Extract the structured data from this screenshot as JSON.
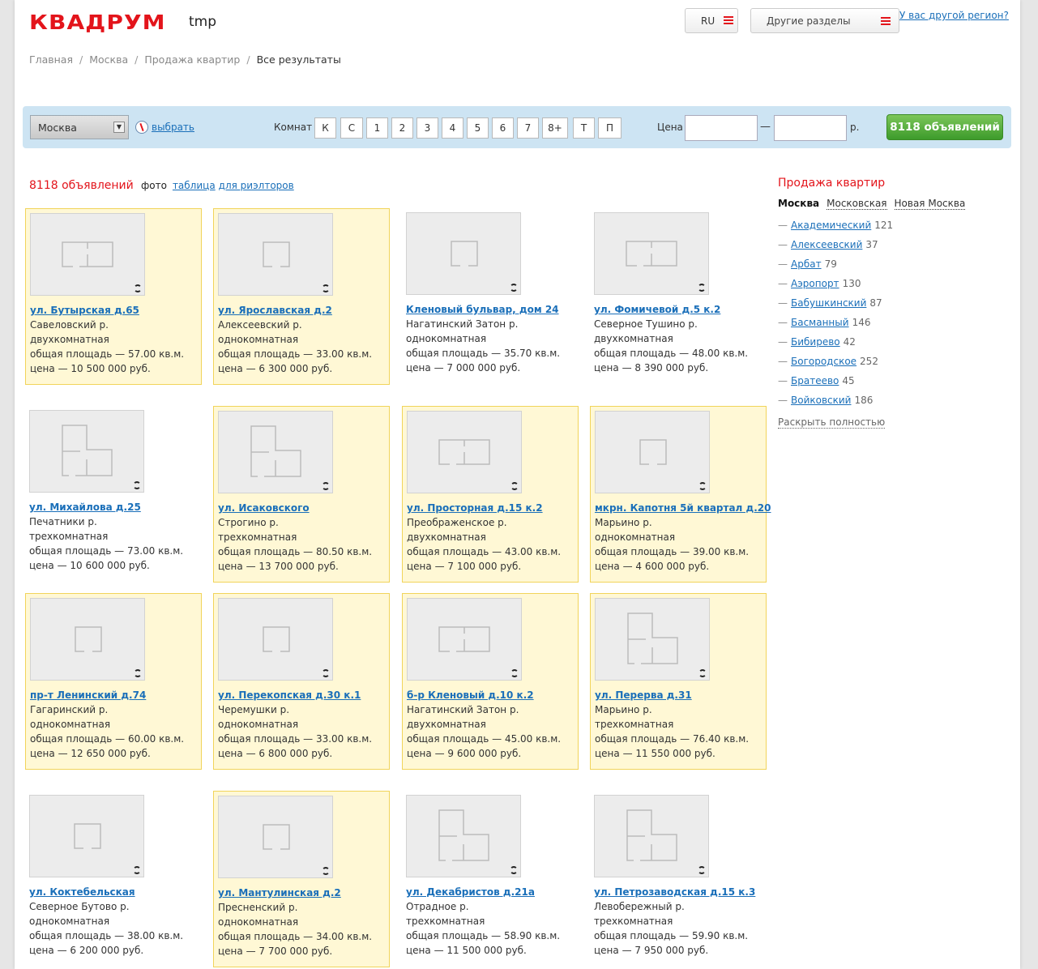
{
  "header": {
    "logo": "КВАДРУМ",
    "site_tag": "tmp",
    "lang": "RU",
    "sections_label": "Другие разделы",
    "region_link": "У вас другой регион?"
  },
  "breadcrumb": [
    "Главная",
    "Москва",
    "Продажа квартир",
    "Все результаты"
  ],
  "filter": {
    "city": "Москва",
    "choose": "выбрать",
    "rooms_label": "Комнат",
    "rooms": [
      "К",
      "С",
      "1",
      "2",
      "3",
      "4",
      "5",
      "6",
      "7",
      "8+",
      "Т",
      "П"
    ],
    "price_label": "Цена",
    "price_from": "",
    "price_to": "",
    "dash": "—",
    "currency": "р.",
    "submit": "8118 объявлений"
  },
  "results": {
    "count_text": "8118 объявлений",
    "view_active": "фото",
    "view_links": [
      "таблица",
      "для риэлторов"
    ]
  },
  "listings": [
    {
      "addr": "ул. Бутырская д.65",
      "district": "Савеловский р.",
      "type": "двухкомнатная",
      "area": "общая площадь — 57.00 кв.м.",
      "price": "цена — 10 500 000 руб.",
      "highlight": true,
      "plan": "two"
    },
    {
      "addr": "ул. Ярославская д.2",
      "district": "Алексеевский р.",
      "type": "однокомнатная",
      "area": "общая площадь — 33.00 кв.м.",
      "price": "цена — 6 300 000 руб.",
      "highlight": true,
      "plan": "one"
    },
    {
      "addr": "Кленовый бульвар, дом 24",
      "district": "Нагатинский Затон р.",
      "type": "однокомнатная",
      "area": "общая площадь — 35.70 кв.м.",
      "price": "цена — 7 000 000 руб.",
      "highlight": false,
      "plan": "one"
    },
    {
      "addr": "ул. Фомичевой д.5 к.2",
      "district": "Северное Тушино р.",
      "type": "двухкомнатная",
      "area": "общая площадь — 48.00 кв.м.",
      "price": "цена — 8 390 000 руб.",
      "highlight": false,
      "plan": "two"
    },
    {
      "addr": "ул. Михайлова д.25",
      "district": "Печатники р.",
      "type": "трехкомнатная",
      "area": "общая площадь — 73.00 кв.м.",
      "price": "цена — 10 600 000 руб.",
      "highlight": false,
      "plan": "three"
    },
    {
      "addr": "ул. Исаковского",
      "district": "Строгино р.",
      "type": "трехкомнатная",
      "area": "общая площадь — 80.50 кв.м.",
      "price": "цена — 13 700 000 руб.",
      "highlight": true,
      "plan": "three"
    },
    {
      "addr": "ул. Просторная д.15 к.2",
      "district": "Преображенское р.",
      "type": "двухкомнатная",
      "area": "общая площадь — 43.00 кв.м.",
      "price": "цена — 7 100 000 руб.",
      "highlight": true,
      "plan": "two"
    },
    {
      "addr": "мкрн. Капотня 5й квартал д.20",
      "district": "Марьино р.",
      "type": "однокомнатная",
      "area": "общая площадь — 39.00 кв.м.",
      "price": "цена — 4 600 000 руб.",
      "highlight": true,
      "plan": "one"
    },
    {
      "addr": "пр-т Ленинский д.74",
      "district": "Гагаринский р.",
      "type": "однокомнатная",
      "area": "общая площадь — 60.00 кв.м.",
      "price": "цена — 12 650 000 руб.",
      "highlight": true,
      "plan": "one"
    },
    {
      "addr": "ул. Перекопская д.30 к.1",
      "district": "Черемушки р.",
      "type": "однокомнатная",
      "area": "общая площадь — 33.00 кв.м.",
      "price": "цена — 6 800 000 руб.",
      "highlight": true,
      "plan": "one"
    },
    {
      "addr": "б-р Кленовый д.10 к.2",
      "district": "Нагатинский Затон р.",
      "type": "двухкомнатная",
      "area": "общая площадь — 45.00 кв.м.",
      "price": "цена — 9 600 000 руб.",
      "highlight": true,
      "plan": "two"
    },
    {
      "addr": "ул. Перерва д.31",
      "district": "Марьино р.",
      "type": "трехкомнатная",
      "area": "общая площадь — 76.40 кв.м.",
      "price": "цена — 11 550 000 руб.",
      "highlight": true,
      "plan": "three"
    },
    {
      "addr": "ул. Коктебельская",
      "district": "Северное Бутово р.",
      "type": "однокомнатная",
      "area": "общая площадь — 38.00 кв.м.",
      "price": "цена — 6 200 000 руб.",
      "highlight": false,
      "plan": "one"
    },
    {
      "addr": "ул. Мантулинская д.2",
      "district": "Пресненский р.",
      "type": "однокомнатная",
      "area": "общая площадь — 34.00 кв.м.",
      "price": "цена — 7 700 000 руб.",
      "highlight": true,
      "plan": "one"
    },
    {
      "addr": "ул. Декабристов д.21а",
      "district": "Отрадное р.",
      "type": "трехкомнатная",
      "area": "общая площадь — 58.90 кв.м.",
      "price": "цена — 11 500 000 руб.",
      "highlight": false,
      "plan": "three"
    },
    {
      "addr": "ул. Петрозаводская д.15 к.3",
      "district": "Левобережный р.",
      "type": "трехкомнатная",
      "area": "общая площадь — 59.90 кв.м.",
      "price": "цена — 7 950 000 руб.",
      "highlight": false,
      "plan": "three"
    }
  ],
  "sidebar": {
    "title": "Продажа квартир",
    "tabs": [
      "Москва",
      "Московская",
      "Новая Москва"
    ],
    "districts": [
      {
        "name": "Академический",
        "count": "121"
      },
      {
        "name": "Алексеевский",
        "count": "37"
      },
      {
        "name": "Арбат",
        "count": "79"
      },
      {
        "name": "Аэропорт",
        "count": "130"
      },
      {
        "name": "Бабушкинский",
        "count": "87"
      },
      {
        "name": "Басманный",
        "count": "146"
      },
      {
        "name": "Бибирево",
        "count": "42"
      },
      {
        "name": "Богородское",
        "count": "252"
      },
      {
        "name": "Братеево",
        "count": "45"
      },
      {
        "name": "Войковский",
        "count": "186"
      }
    ],
    "expand": "Раскрыть полностью",
    "dash": "—"
  },
  "colors": {
    "brand": "#e3141b",
    "link": "#1a6fb9",
    "highlight": "#fff8d5",
    "filter_bg": "#cde4f3",
    "submit": "#3d9b2b"
  }
}
